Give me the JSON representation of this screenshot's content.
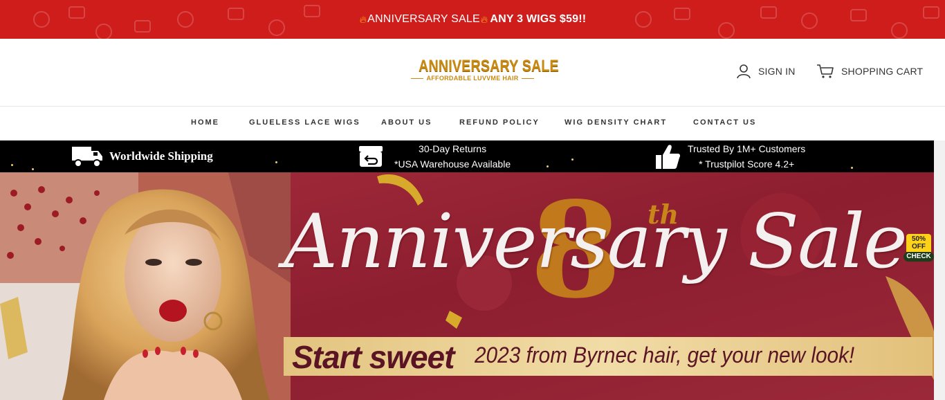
{
  "promo": {
    "flame_icon": "flame-icon",
    "text_sale": "ANNIVERSARY SALE",
    "text_offer": "ANY 3 WIGS $59!!",
    "background": "#cf1d1b"
  },
  "header": {
    "logo": {
      "title": "ANNIVERSARY SALE",
      "subtitle": "AFFORDABLE LUVVME HAIR",
      "color": "#c98a12"
    },
    "sign_in": {
      "label": "SIGN IN",
      "icon": "user-icon"
    },
    "cart": {
      "label": "SHOPPING CART",
      "icon": "cart-icon"
    }
  },
  "nav": {
    "items": [
      {
        "label": "HOME"
      },
      {
        "label": "GLUELESS LACE WIGS"
      },
      {
        "label": "ABOUT US"
      },
      {
        "label": "REFUND POLICY"
      },
      {
        "label": "WIG DENSITY CHART"
      },
      {
        "label": "CONTACT US"
      }
    ]
  },
  "features": {
    "shipping": {
      "icon": "truck-icon",
      "label": "Worldwide Shipping"
    },
    "returns": {
      "icon": "return-box-icon",
      "line1": "30-Day Returns",
      "line2": "*USA Warehouse Available"
    },
    "trust": {
      "icon": "thumbs-up-icon",
      "line1": "Trusted By 1M+ Customers",
      "line2": "* Trustpilot Score 4.2+"
    }
  },
  "hero": {
    "number": "8",
    "ordinal": "th",
    "script_title": "Anniversary Sale",
    "banner_bold": "Start sweet",
    "banner_rest": "2023 from  Byrnec hair,  get your new look!",
    "background": "#8e2032",
    "accent": "#c8861a"
  },
  "badge": {
    "line1": "50%",
    "line2": "OFF",
    "cta": "CHECK"
  }
}
